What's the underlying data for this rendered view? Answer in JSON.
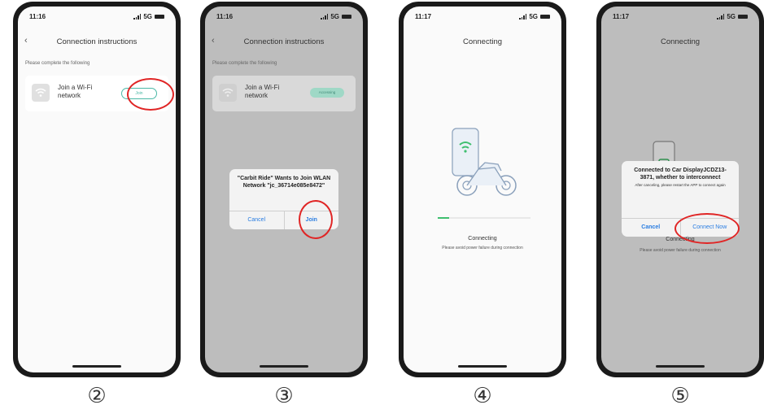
{
  "colors": {
    "accent": "#4bb8a6",
    "annotation": "#e02525",
    "link": "#2a7de1",
    "progress": "#3fbf6f"
  },
  "phones": [
    {
      "time": "11:16",
      "network": "5G",
      "title": "Connection instructions",
      "hint": "Please complete the following",
      "card_label": "Join a Wi-Fi network",
      "join_label": "Join"
    },
    {
      "time": "11:16",
      "network": "5G",
      "title": "Connection instructions",
      "hint": "Please complete the following",
      "card_label": "Join a Wi-Fi network",
      "accessing_label": "Accessing",
      "dialog_title": "\"Carbit Ride\" Wants to Join WLAN Network \"jc_36714e085e8472\"",
      "cancel_label": "Cancel",
      "join_label": "Join"
    },
    {
      "time": "11:17",
      "network": "5G",
      "title": "Connecting",
      "progress": 0.12,
      "status_label": "Connecting",
      "warning": "Please avoid power failure during connection"
    },
    {
      "time": "11:17",
      "network": "5G",
      "title": "Connecting",
      "dialog_title": "Connected to Car DisplayJCDZ13-3871, whether to interconnect",
      "dialog_note": "After canceling, please restart the APP to connect again",
      "cancel_label": "Cancel",
      "connect_label": "Connect Now",
      "status_label": "Connecting",
      "warning": "Please avoid power failure during connection"
    }
  ],
  "steps": [
    "②",
    "③",
    "④",
    "⑤"
  ]
}
